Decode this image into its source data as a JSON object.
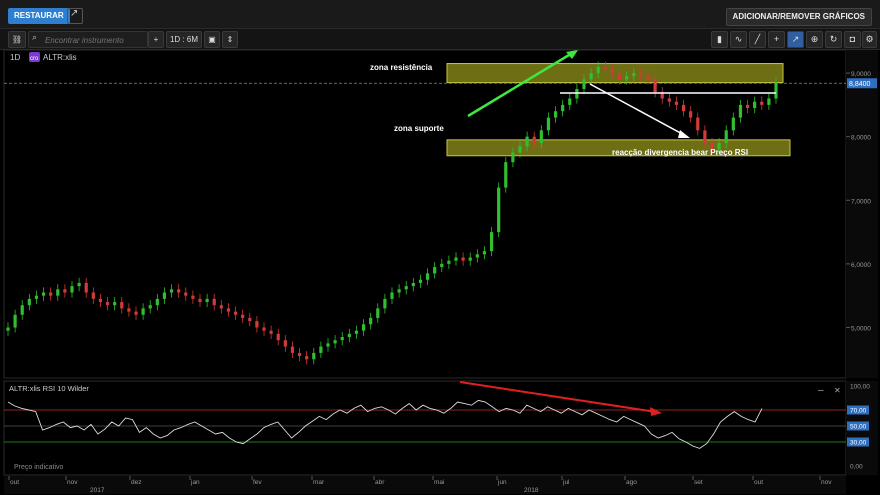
{
  "topbar": {
    "restore_label": "RESTAURAR",
    "add_remove_label": "ADICIONAR/REMOVER GRÁFICOS"
  },
  "toolbar": {
    "search_placeholder": "Encontrar instrumento",
    "interval_label": "1D : 6M",
    "add_label": "+"
  },
  "main_chart": {
    "timeframe": "1D",
    "badge": "cro",
    "symbol": "ALTR:xlis",
    "price_label": "8,8400",
    "y_ticks": [
      "9,0000",
      "8,0000",
      "7,0000",
      "6,0000",
      "5,0000"
    ],
    "annotations": {
      "resistance": "zona resistência",
      "support": "zona suporte",
      "divergence": "reacção divergencia bear Preço RSI"
    },
    "colors": {
      "up": "#2fbf2f",
      "down": "#d43a3a",
      "zone": "#8a8a1a"
    }
  },
  "rsi_panel": {
    "title": "ALTR:xlis  RSI 10 Wilder",
    "footer_label": "Preço indicativo",
    "y_ticks": [
      "100,00",
      "70,00",
      "50,00",
      "30,00",
      "0,00"
    ],
    "minimize_label": "–",
    "close_label": "✕"
  },
  "x_axis": {
    "months": [
      "out",
      "nov",
      "dez",
      "jan",
      "fev",
      "mar",
      "abr",
      "mai",
      "jun",
      "jul",
      "ago",
      "set",
      "out",
      "nov"
    ],
    "years": [
      "2017",
      "2018"
    ]
  },
  "chart_data": {
    "type": "candlestick",
    "main_y_range": [
      4.3,
      9.3
    ],
    "closes": [
      5.0,
      5.2,
      5.35,
      5.45,
      5.5,
      5.55,
      5.5,
      5.6,
      5.55,
      5.65,
      5.7,
      5.55,
      5.45,
      5.4,
      5.35,
      5.4,
      5.3,
      5.25,
      5.2,
      5.3,
      5.35,
      5.45,
      5.55,
      5.6,
      5.55,
      5.5,
      5.45,
      5.4,
      5.45,
      5.35,
      5.3,
      5.25,
      5.2,
      5.15,
      5.1,
      5.0,
      4.95,
      4.9,
      4.8,
      4.7,
      4.6,
      4.55,
      4.5,
      4.6,
      4.7,
      4.75,
      4.8,
      4.85,
      4.9,
      4.95,
      5.05,
      5.15,
      5.3,
      5.45,
      5.55,
      5.6,
      5.65,
      5.7,
      5.75,
      5.85,
      5.95,
      6.0,
      6.05,
      6.1,
      6.05,
      6.1,
      6.15,
      6.2,
      6.5,
      7.2,
      7.6,
      7.75,
      7.85,
      8.0,
      7.9,
      8.1,
      8.3,
      8.4,
      8.5,
      8.6,
      8.75,
      8.9,
      9.0,
      9.1,
      9.05,
      9.0,
      8.9,
      8.95,
      9.0,
      8.95,
      8.9,
      8.7,
      8.6,
      8.55,
      8.5,
      8.4,
      8.3,
      8.1,
      7.9,
      7.8,
      7.9,
      8.1,
      8.3,
      8.5,
      8.45,
      8.55,
      8.5,
      8.6,
      8.85
    ],
    "resistance_zone": [
      8.85,
      9.15
    ],
    "support_zone": [
      7.7,
      7.95
    ],
    "rsi": [
      80,
      75,
      72,
      70,
      68,
      45,
      48,
      52,
      55,
      48,
      50,
      45,
      52,
      40,
      46,
      55,
      50,
      60,
      58,
      42,
      48,
      40,
      35,
      38,
      45,
      48,
      52,
      55,
      50,
      45,
      40,
      42,
      35,
      30,
      28,
      34,
      40,
      48,
      52,
      55,
      45,
      35,
      42,
      50,
      56,
      62,
      58,
      65,
      70,
      66,
      72,
      76,
      68,
      72,
      74,
      70,
      65,
      72,
      78,
      70,
      76,
      72,
      70,
      66,
      72,
      80,
      78,
      76,
      82,
      80,
      74,
      68,
      72,
      70,
      66,
      76,
      72,
      68,
      74,
      70,
      66,
      72,
      68,
      64,
      70,
      66,
      62,
      58,
      55,
      62,
      58,
      54,
      50,
      40,
      35,
      38,
      42,
      34,
      30,
      25,
      22,
      28,
      40,
      55,
      62,
      68,
      62,
      58,
      55,
      72
    ],
    "rsi_levels": [
      70,
      50,
      30
    ]
  }
}
